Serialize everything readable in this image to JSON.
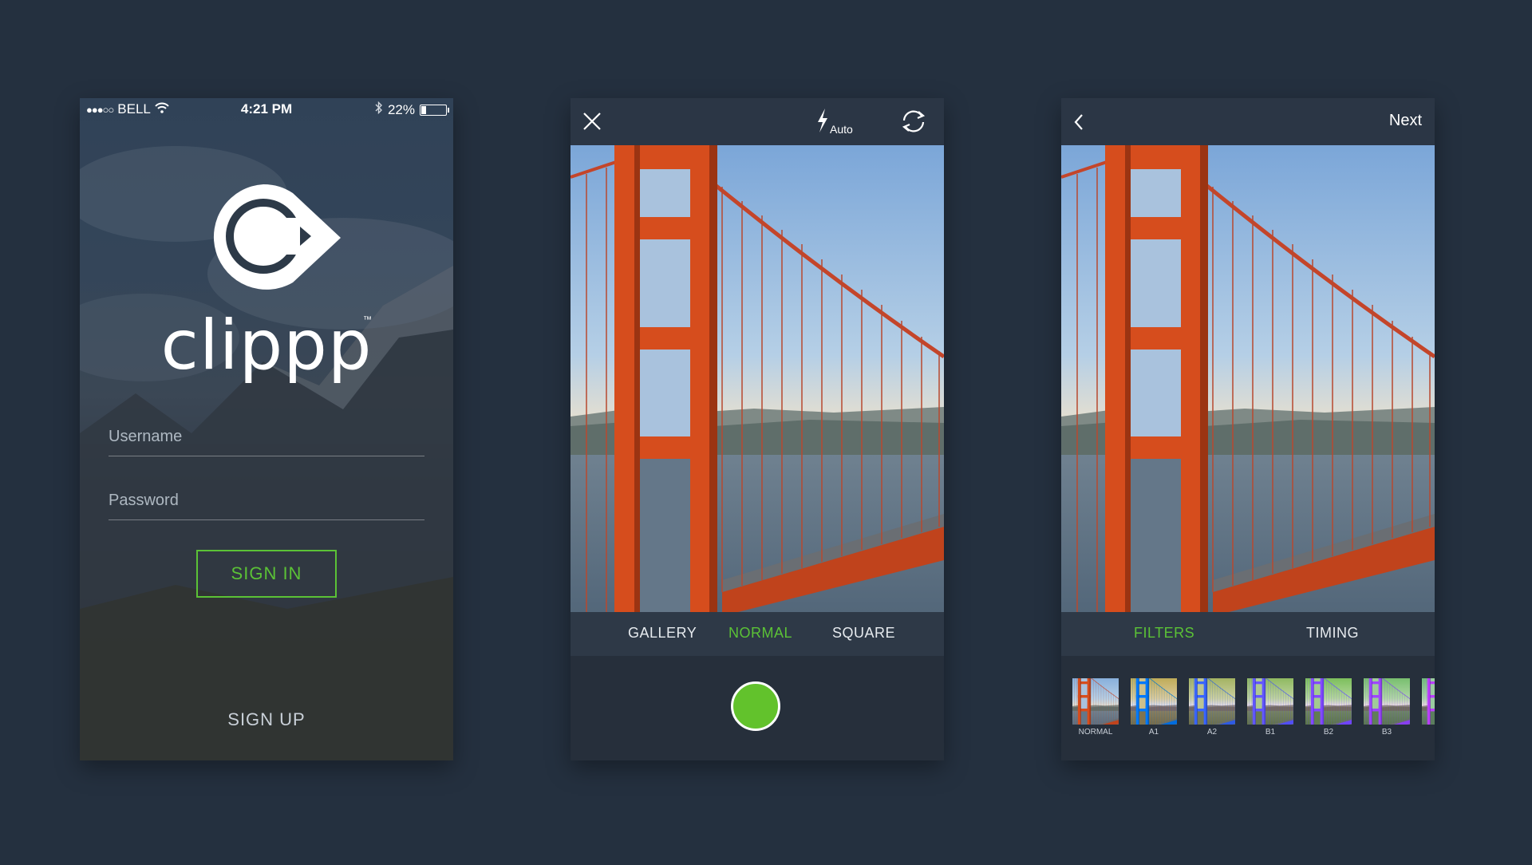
{
  "login": {
    "status": {
      "carrier": "BELL",
      "time": "4:21 PM",
      "battery": "22%",
      "battery_level": 0.22,
      "signal_dots": "●●●○○"
    },
    "brand": "clippp",
    "trademark": "™",
    "username_placeholder": "Username",
    "password_placeholder": "Password",
    "sign_in_label": "SIGN IN",
    "sign_up_label": "SIGN UP"
  },
  "camera": {
    "flash_mode": "Auto",
    "modes": [
      {
        "label": "GALLERY",
        "active": false
      },
      {
        "label": "NORMAL",
        "active": true
      },
      {
        "label": "SQUARE",
        "active": false
      }
    ]
  },
  "filters": {
    "next_label": "Next",
    "tabs": [
      {
        "label": "FILTERS",
        "active": true
      },
      {
        "label": "TIMING",
        "active": false
      }
    ],
    "items": [
      {
        "label": "NORMAL"
      },
      {
        "label": "A1"
      },
      {
        "label": "A2"
      },
      {
        "label": "B1"
      },
      {
        "label": "B2"
      },
      {
        "label": "B3"
      }
    ]
  },
  "colors": {
    "accent": "#5bc236",
    "background": "#24303f",
    "bar": "#2b3645"
  },
  "icons": {
    "close": "close-icon",
    "flash": "flash-icon",
    "switch_camera": "switch-camera-icon",
    "back": "back-icon",
    "wifi": "wifi-icon",
    "bluetooth": "bluetooth-icon"
  }
}
